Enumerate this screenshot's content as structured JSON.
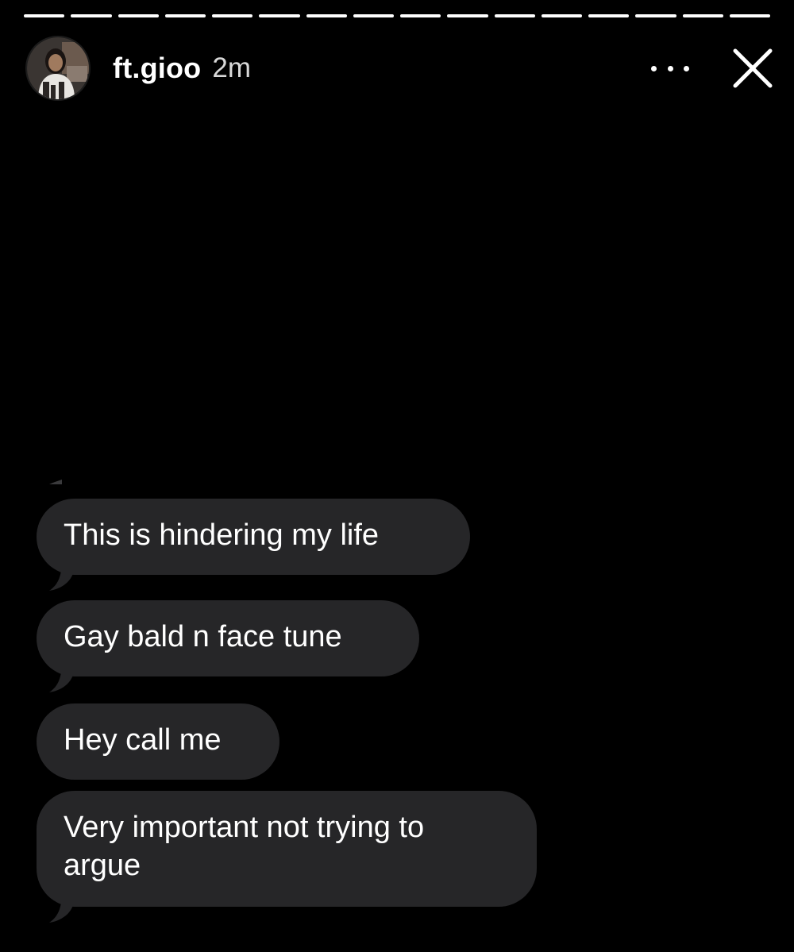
{
  "story": {
    "progress_segments_total": 16,
    "progress_segments_viewed": 16
  },
  "header": {
    "username": "ft.gioo",
    "time_ago": "2m",
    "more_icon": "more-horizontal-icon",
    "close_icon": "close-x-icon"
  },
  "messages": [
    {
      "text": "This is hindering my life"
    },
    {
      "text": "Gay bald n face tune"
    },
    {
      "text": "Hey call me"
    },
    {
      "text": "Very important not trying to argue"
    }
  ],
  "colors": {
    "background": "#000000",
    "bubble": "#262628",
    "text": "#ffffff"
  }
}
